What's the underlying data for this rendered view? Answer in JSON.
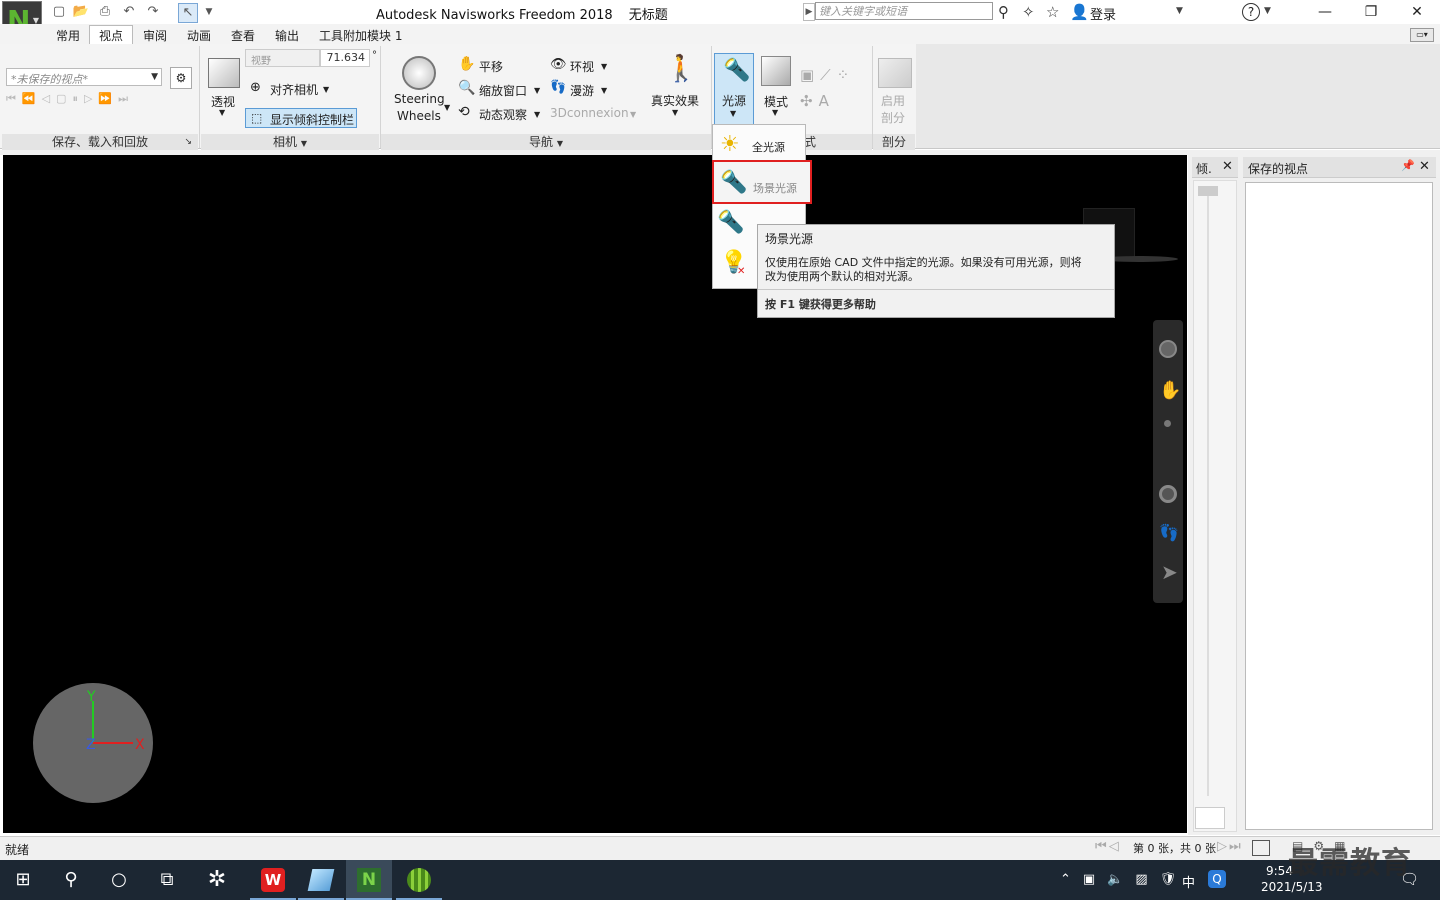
{
  "titlebar": {
    "app_title": "Autodesk Navisworks Freedom 2018",
    "doc_title": "无标题",
    "search_placeholder": "键入关键字或短语",
    "login_label": "登录",
    "help_label": "?"
  },
  "tabs": [
    "常用",
    "视点",
    "审阅",
    "动画",
    "查看",
    "输出",
    "工具附加模块 1"
  ],
  "active_tab": "视点",
  "ribbon": {
    "save_panel": {
      "viewpoint_select": "*未保存的视点*",
      "label": "保存、载入和回放"
    },
    "camera_panel": {
      "perspective_label": "透视",
      "fov_label": "视野",
      "fov_value": "71.634",
      "fov_unit": "°",
      "align_camera_label": "对齐相机",
      "tilt_bar_label": "显示倾斜控制栏",
      "label": "相机"
    },
    "nav_panel": {
      "steering_line1": "Steering",
      "steering_line2": "Wheels",
      "pan_label": "平移",
      "zoom_window_label": "缩放窗口",
      "orbit_label": "动态观察",
      "look_label": "环视",
      "walk_label": "漫游",
      "connexion_label": "3Dconnexion",
      "realism_label": "真实效果",
      "label": "导航"
    },
    "render_panel": {
      "light_label": "光源",
      "mode_label": "模式",
      "style_label_partial": "式"
    },
    "section_panel": {
      "enable_line1": "启用",
      "enable_line2": "剖分",
      "label": "剖分"
    }
  },
  "light_menu": {
    "items": [
      "全光源",
      "场景光源",
      "头光源",
      "无光源"
    ]
  },
  "tooltip": {
    "title": "场景光源",
    "body_line1": "仅使用在原始 CAD 文件中指定的光源。如果没有可用光源，则将",
    "body_line2": "改为使用两个默认的相对光源。",
    "help": "按 F1 键获得更多帮助"
  },
  "dock": {
    "tilt_title": "倾.",
    "saved_viewpoints_title": "保存的视点"
  },
  "status": {
    "ready": "就绪",
    "page_info": "第 0 张，共 0 张"
  },
  "taskbar": {
    "time": "9:54",
    "date": "2021/5/13",
    "ime": "中",
    "watermark": "最需教育"
  },
  "colors": {
    "viewport_bg": "#000000",
    "selected_button": "#cde6f7",
    "highlight_box": "#e02020",
    "taskbar_bg": "#1c2733"
  }
}
